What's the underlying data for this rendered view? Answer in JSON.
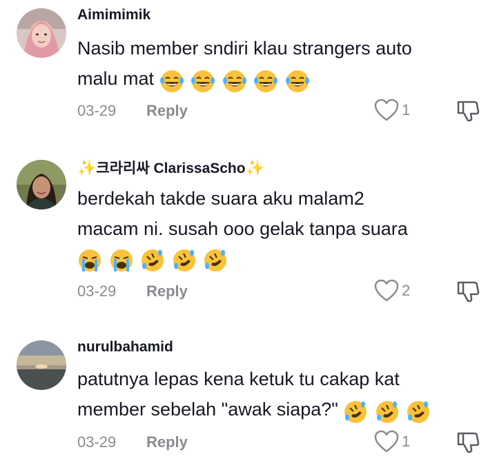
{
  "comments": [
    {
      "username": "Aimimimik",
      "lines": [
        "Nasib member sndiri klau strangers auto",
        "malu mat"
      ],
      "emojis": [
        "laughing-tears",
        "laughing-tears",
        "laughing-tears",
        "laughing-tears",
        "laughing-tears"
      ],
      "date": "03-29",
      "reply_label": "Reply",
      "likes": "1"
    },
    {
      "username_prefix_icon": "sparkles",
      "username": "크라리싸 ClarissaScho",
      "username_suffix_icon": "sparkles",
      "lines": [
        "berdekah takde suara aku malam2",
        "macam ni. susah ooo gelak tanpa suara"
      ],
      "emojis": [
        "loudly-crying",
        "loudly-crying",
        "rofl",
        "rofl",
        "rofl"
      ],
      "date": "03-29",
      "reply_label": "Reply",
      "likes": "2"
    },
    {
      "username": "nurulbahamid",
      "lines": [
        "patutnya lepas kena ketuk tu cakap kat",
        "member sebelah \"awak siapa?\""
      ],
      "emojis": [
        "rofl",
        "rofl",
        "rofl"
      ],
      "date": "03-29",
      "reply_label": "Reply",
      "likes": "1"
    }
  ],
  "colors": {
    "text": "#161823",
    "muted": "#8a8b91",
    "emoji": "#f9c23c"
  }
}
